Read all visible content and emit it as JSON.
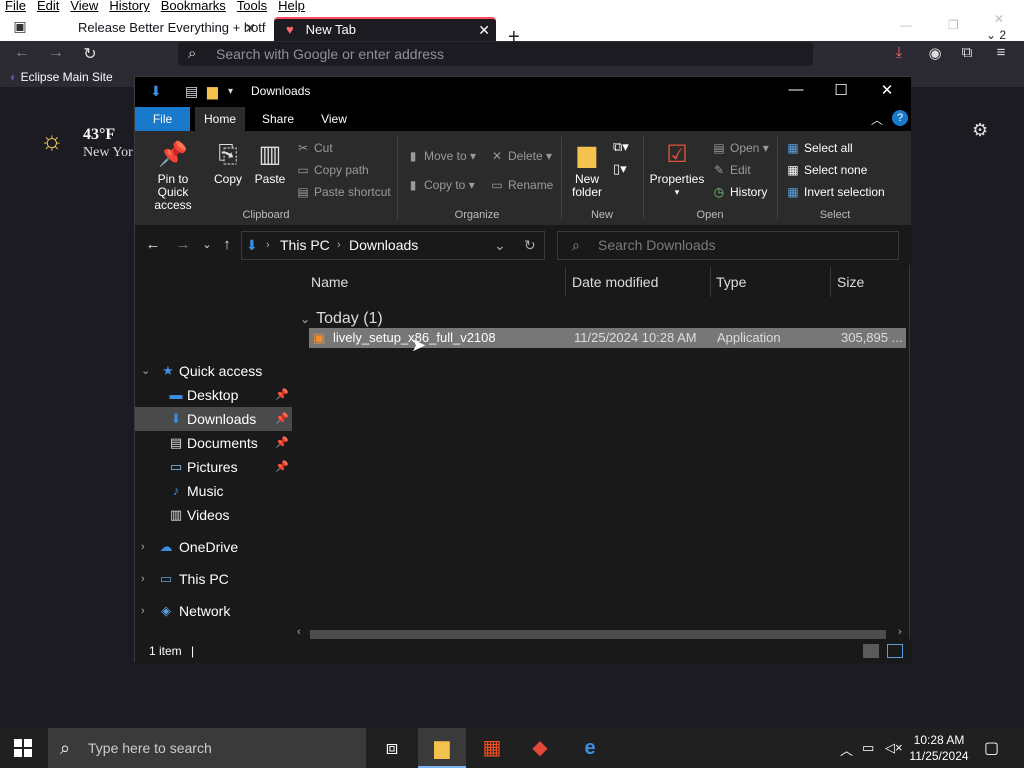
{
  "browser": {
    "menu": [
      "File",
      "Edit",
      "View",
      "History",
      "Bookmarks",
      "Tools",
      "Help"
    ],
    "tabs": [
      {
        "title": "Release Better Everything + hotf",
        "active": false
      },
      {
        "title": "New Tab",
        "active": true
      }
    ],
    "tab_count": "2",
    "url_placeholder": "Search with Google or enter address",
    "bookmark_label": "Eclipse Main Site"
  },
  "newtab": {
    "weather_temp": "43°F",
    "weather_location": "New Yor"
  },
  "explorer": {
    "title": "Downloads",
    "ribbon_tabs": [
      "File",
      "Home",
      "Share",
      "View"
    ],
    "clipboard": {
      "pin": "Pin to Quick access",
      "copy": "Copy",
      "paste": "Paste",
      "cut": "Cut",
      "copy_path": "Copy path",
      "paste_shortcut": "Paste shortcut",
      "group": "Clipboard"
    },
    "organize": {
      "move_to": "Move to",
      "copy_to": "Copy to",
      "delete": "Delete",
      "rename": "Rename",
      "group": "Organize"
    },
    "new": {
      "new_folder": "New folder",
      "group": "New"
    },
    "open": {
      "properties": "Properties",
      "open": "Open",
      "edit": "Edit",
      "history": "History",
      "group": "Open"
    },
    "select": {
      "select_all": "Select all",
      "select_none": "Select none",
      "invert": "Invert selection",
      "group": "Select"
    },
    "address": {
      "crumbs": [
        "This PC",
        "Downloads"
      ],
      "search_placeholder": "Search Downloads"
    },
    "nav": {
      "quick_access": "Quick access",
      "items": [
        {
          "label": "Desktop",
          "pinned": true
        },
        {
          "label": "Downloads",
          "pinned": true,
          "selected": true
        },
        {
          "label": "Documents",
          "pinned": true
        },
        {
          "label": "Pictures",
          "pinned": true
        },
        {
          "label": "Music",
          "pinned": false
        },
        {
          "label": "Videos",
          "pinned": false
        }
      ],
      "onedrive": "OneDrive",
      "this_pc": "This PC",
      "network": "Network"
    },
    "columns": [
      "Name",
      "Date modified",
      "Type",
      "Size"
    ],
    "group_header": "Today (1)",
    "files": [
      {
        "name": "lively_setup_x86_full_v2108",
        "date": "11/25/2024 10:28 AM",
        "type": "Application",
        "size": "305,895 ..."
      }
    ],
    "status": "1 item"
  },
  "taskbar": {
    "search_placeholder": "Type here to search",
    "time": "10:28 AM",
    "date": "11/25/2024"
  }
}
